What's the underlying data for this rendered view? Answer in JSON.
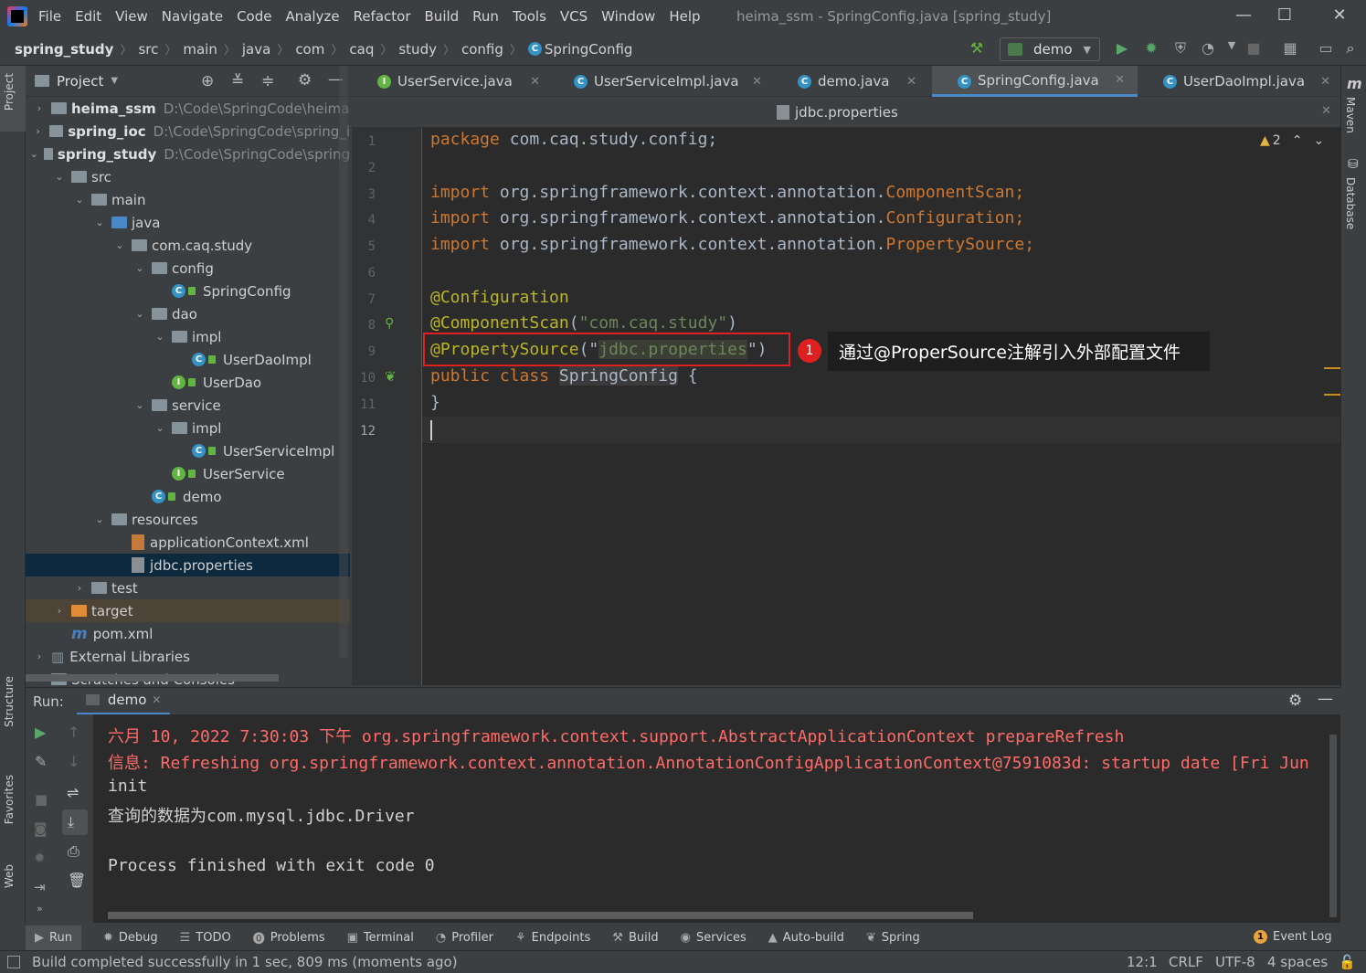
{
  "window": {
    "title": "heima_ssm - SpringConfig.java [spring_study]"
  },
  "menu": [
    "File",
    "Edit",
    "View",
    "Navigate",
    "Code",
    "Analyze",
    "Refactor",
    "Build",
    "Run",
    "Tools",
    "VCS",
    "Window",
    "Help"
  ],
  "breadcrumb": [
    "spring_study",
    "src",
    "main",
    "java",
    "com",
    "caq",
    "study",
    "config",
    "SpringConfig"
  ],
  "run_config": "demo",
  "project_panel": {
    "title": "Project"
  },
  "tree": [
    {
      "label": "heima_ssm",
      "path": "D:\\Code\\SpringCode\\heima",
      "bold": true,
      "indent": 0,
      "arrow": "›",
      "kind": "module"
    },
    {
      "label": "spring_ioc",
      "path": "D:\\Code\\SpringCode\\spring_i",
      "bold": true,
      "indent": 0,
      "arrow": "›",
      "kind": "module"
    },
    {
      "label": "spring_study",
      "path": "D:\\Code\\SpringCode\\spring",
      "bold": true,
      "indent": 0,
      "arrow": "⌄",
      "kind": "module"
    },
    {
      "label": "src",
      "indent": 1,
      "arrow": "⌄",
      "kind": "folder"
    },
    {
      "label": "main",
      "indent": 2,
      "arrow": "⌄",
      "kind": "folder"
    },
    {
      "label": "java",
      "indent": 3,
      "arrow": "⌄",
      "kind": "srcfolder"
    },
    {
      "label": "com.caq.study",
      "indent": 4,
      "arrow": "⌄",
      "kind": "package"
    },
    {
      "label": "config",
      "indent": 5,
      "arrow": "⌄",
      "kind": "package"
    },
    {
      "label": "SpringConfig",
      "indent": 6,
      "arrow": "",
      "kind": "class"
    },
    {
      "label": "dao",
      "indent": 5,
      "arrow": "⌄",
      "kind": "package"
    },
    {
      "label": "impl",
      "indent": 6,
      "arrow": "⌄",
      "kind": "package"
    },
    {
      "label": "UserDaoImpl",
      "indent": 7,
      "arrow": "",
      "kind": "class"
    },
    {
      "label": "UserDao",
      "indent": 6,
      "arrow": "",
      "kind": "interface"
    },
    {
      "label": "service",
      "indent": 5,
      "arrow": "⌄",
      "kind": "package"
    },
    {
      "label": "impl",
      "indent": 6,
      "arrow": "⌄",
      "kind": "package"
    },
    {
      "label": "UserServiceImpl",
      "indent": 7,
      "arrow": "",
      "kind": "class"
    },
    {
      "label": "UserService",
      "indent": 6,
      "arrow": "",
      "kind": "interface"
    },
    {
      "label": "demo",
      "indent": 5,
      "arrow": "",
      "kind": "runclass"
    },
    {
      "label": "resources",
      "indent": 3,
      "arrow": "⌄",
      "kind": "resfolder"
    },
    {
      "label": "applicationContext.xml",
      "indent": 4,
      "arrow": "",
      "kind": "xml"
    },
    {
      "label": "jdbc.properties",
      "indent": 4,
      "arrow": "",
      "kind": "props",
      "selected": true
    },
    {
      "label": "test",
      "indent": 2,
      "arrow": "›",
      "kind": "folder"
    },
    {
      "label": "target",
      "indent": 1,
      "arrow": "›",
      "kind": "orangefolder",
      "target": true
    },
    {
      "label": "pom.xml",
      "indent": 1,
      "arrow": "",
      "kind": "maven"
    },
    {
      "label": "External Libraries",
      "indent": 0,
      "arrow": "›",
      "kind": "libs"
    },
    {
      "label": "Scratches and Consoles",
      "indent": 0,
      "arrow": "›",
      "kind": "scratch"
    }
  ],
  "tabs": [
    "UserService.java",
    "UserServiceImpl.java",
    "demo.java",
    "SpringConfig.java",
    "UserDaoImpl.java"
  ],
  "active_tab": "SpringConfig.java",
  "subtab": "jdbc.properties",
  "warnings": "2",
  "code": {
    "line_numbers": [
      "1",
      "2",
      "3",
      "4",
      "5",
      "6",
      "7",
      "8",
      "9",
      "10",
      "11",
      "12"
    ],
    "l1_kw": "package",
    "l1_rest": " com.caq.study.config;",
    "import_kw": "import",
    "l3_pkg": " org.springframework.context.annotation.",
    "l3_cls": "ComponentScan;",
    "l4_pkg": " org.springframework.context.annotation.",
    "l4_cls": "Configuration;",
    "l5_pkg": " org.springframework.context.annotation.",
    "l5_cls": "PropertySource;",
    "l7": "@Configuration",
    "l8_ann": "@ComponentScan",
    "l8_open": "(",
    "l8_str": "\"com.caq.study\"",
    "l8_close": ")",
    "l9_ann": "@PropertySource",
    "l9_open": "(\"",
    "l9_str": "jdbc.properties",
    "l9_close": "\")",
    "l10_kw": "public class ",
    "l10_cls": "SpringConfig",
    "l10_rest": " {",
    "l11": "}"
  },
  "callout": {
    "number": "1",
    "text": "通过@ProperSource注解引入外部配置文件"
  },
  "run_panel": {
    "label": "Run:",
    "tab": "demo"
  },
  "console": [
    {
      "text": "六月 10, 2022 7:30:03 下午 org.springframework.context.support.AbstractApplicationContext prepareRefresh",
      "type": "err"
    },
    {
      "text": "信息: Refreshing org.springframework.context.annotation.AnnotationConfigApplicationContext@7591083d: startup date [Fri Jun",
      "type": "err"
    },
    {
      "text": "init",
      "type": "out"
    },
    {
      "text": "查询的数据为com.mysql.jdbc.Driver",
      "type": "out"
    },
    {
      "text": "",
      "type": "out"
    },
    {
      "text": "Process finished with exit code 0",
      "type": "out"
    }
  ],
  "bottom_tools": [
    "Run",
    "Debug",
    "TODO",
    "Problems",
    "Terminal",
    "Profiler",
    "Endpoints",
    "Build",
    "Services",
    "Auto-build",
    "Spring"
  ],
  "event_log": {
    "count": "1",
    "label": "Event Log"
  },
  "left_vtabs": {
    "project": "Project",
    "structure": "Structure",
    "favorites": "Favorites",
    "web": "Web"
  },
  "right_vtabs": {
    "maven": "Maven",
    "database": "Database"
  },
  "status": {
    "message": "Build completed successfully in 1 sec, 809 ms (moments ago)",
    "position": "12:1",
    "line_sep": "CRLF",
    "encoding": "UTF-8",
    "indent": "4 spaces"
  }
}
